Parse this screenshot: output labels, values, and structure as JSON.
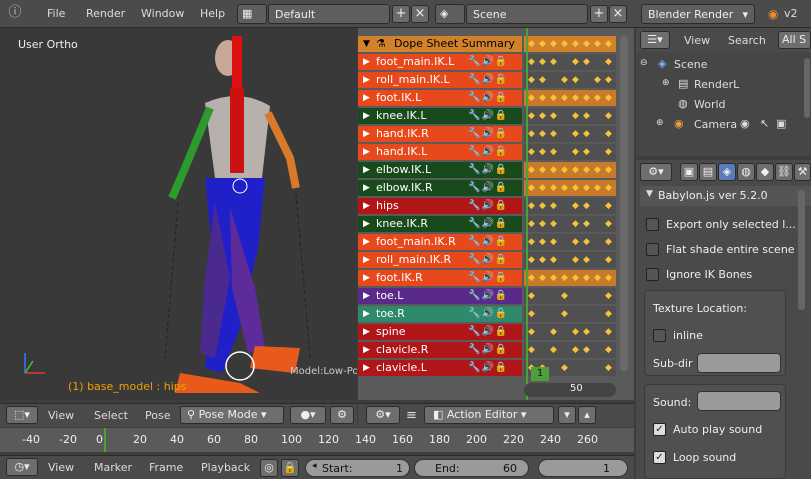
{
  "topbar": {
    "menus": [
      "File",
      "Render",
      "Window",
      "Help"
    ],
    "layout": "Default",
    "scene": "Scene",
    "engine": "Blender Render",
    "version": "v2"
  },
  "viewport": {
    "label": "User Ortho",
    "object_label": "(1) base_model : hips",
    "mesh_label": "Model:Low-Poly",
    "header": {
      "view": "View",
      "select": "Select",
      "pose": "Pose",
      "mode": "Pose Mode"
    }
  },
  "dopesheet": {
    "summary": "Dope Sheet Summary",
    "channels": [
      {
        "name": "foot_main.IK.L",
        "color": "#e8491c"
      },
      {
        "name": "roll_main.IK.L",
        "color": "#e8491c"
      },
      {
        "name": "foot.IK.L",
        "color": "#e8491c"
      },
      {
        "name": "knee.IK.L",
        "color": "#194a1c"
      },
      {
        "name": "hand.IK.R",
        "color": "#e8491c"
      },
      {
        "name": "hand.IK.L",
        "color": "#e8491c"
      },
      {
        "name": "elbow.IK.L",
        "color": "#194a1c"
      },
      {
        "name": "elbow.IK.R",
        "color": "#194a1c"
      },
      {
        "name": "hips",
        "color": "#b01518"
      },
      {
        "name": "knee.IK.R",
        "color": "#194a1c"
      },
      {
        "name": "foot_main.IK.R",
        "color": "#e8491c"
      },
      {
        "name": "roll_main.IK.R",
        "color": "#e8491c"
      },
      {
        "name": "foot.IK.R",
        "color": "#e8491c"
      },
      {
        "name": "toe.L",
        "color": "#5a2a8a"
      },
      {
        "name": "toe.R",
        "color": "#2e8a6a"
      },
      {
        "name": "spine",
        "color": "#b01518"
      },
      {
        "name": "clavicle.R",
        "color": "#b01518"
      },
      {
        "name": "clavicle.L",
        "color": "#b01518"
      }
    ],
    "current_frame": "1",
    "scroll_value": "50",
    "editor": "Action Editor"
  },
  "outliner": {
    "view": "View",
    "search": "Search",
    "filter": "All S",
    "items": [
      "Scene",
      "RenderL",
      "World",
      "Camera"
    ]
  },
  "properties": {
    "panel_title": "Babylon.js ver 5.2.0",
    "export_selected": "Export only selected l...",
    "flat_shade": "Flat shade entire scene",
    "ignore_ik": "Ignore IK Bones",
    "texture_location": "Texture Location:",
    "inline": "inline",
    "subdir": "Sub-dir",
    "sound": "Sound:",
    "auto_play": "Auto play sound",
    "loop": "Loop sound"
  },
  "timeline": {
    "ticks": [
      "-40",
      "-20",
      "0",
      "20",
      "40",
      "60",
      "80",
      "100",
      "120",
      "140",
      "160",
      "180",
      "200",
      "220",
      "240",
      "260"
    ],
    "view": "View",
    "marker": "Marker",
    "frame": "Frame",
    "playback": "Playback",
    "start_label": "Start:",
    "start": "1",
    "end_label": "End:",
    "end": "60",
    "current": "1"
  }
}
